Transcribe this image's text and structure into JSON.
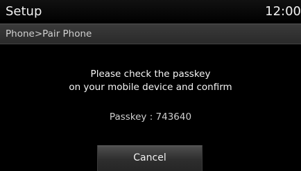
{
  "header": {
    "title": "Setup",
    "clock": "12:00"
  },
  "breadcrumb": "Phone>Pair Phone",
  "dialog": {
    "message_line1": "Please check the passkey",
    "message_line2": "on your mobile device and confirm",
    "passkey": "Passkey : 743640",
    "cancel_label": "Cancel"
  }
}
